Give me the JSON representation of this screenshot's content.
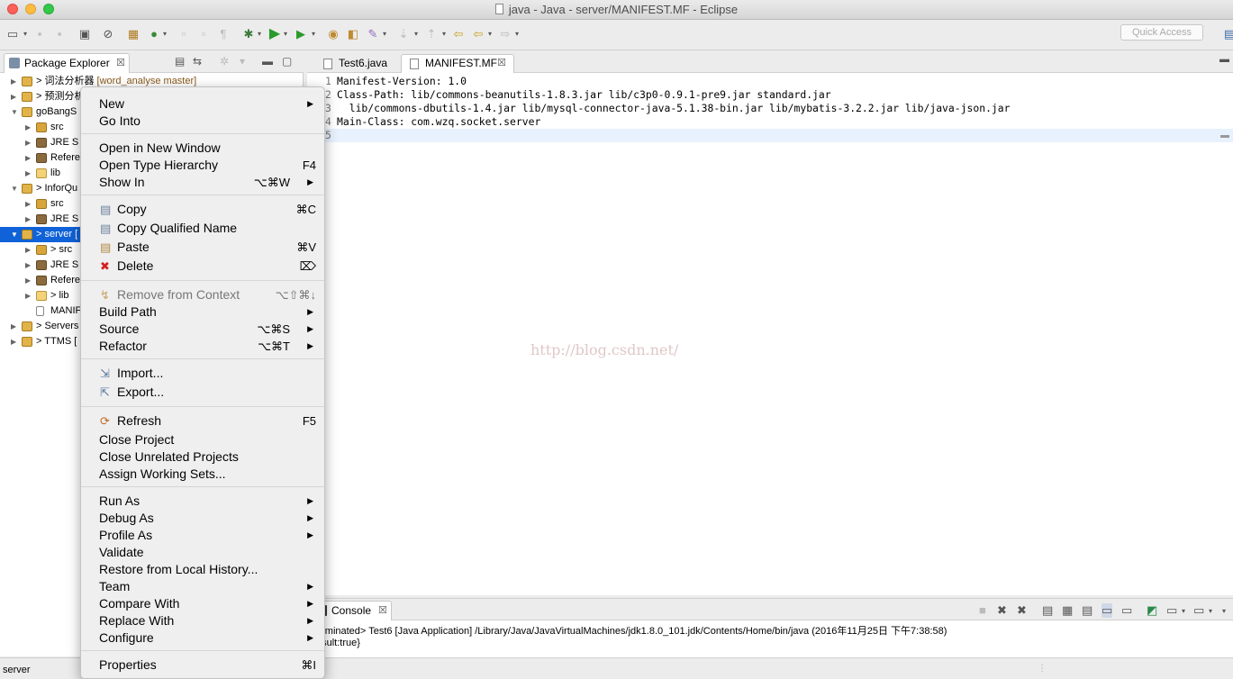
{
  "window": {
    "title": "java - Java - server/MANIFEST.MF - Eclipse"
  },
  "toolbar": {
    "quick_access": "Quick Access"
  },
  "package_explorer": {
    "tab_label": "Package Explorer",
    "rows": [
      {
        "label": "> 词法分析器",
        "decoration": " [word_analyse master]",
        "indent": 0,
        "expanded": false,
        "icon": "proj"
      },
      {
        "label": "> 预测分析",
        "decoration": "",
        "indent": 0,
        "expanded": false,
        "icon": "proj"
      },
      {
        "label": "goBangS",
        "decoration": "",
        "indent": 0,
        "expanded": true,
        "icon": "proj"
      },
      {
        "label": "src",
        "decoration": "",
        "indent": 1,
        "expanded": false,
        "icon": "src"
      },
      {
        "label": "JRE S",
        "decoration": "",
        "indent": 1,
        "expanded": false,
        "icon": "jre"
      },
      {
        "label": "Refere",
        "decoration": "",
        "indent": 1,
        "expanded": false,
        "icon": "ref"
      },
      {
        "label": "lib",
        "decoration": "",
        "indent": 1,
        "expanded": false,
        "icon": "folder"
      },
      {
        "label": "> InforQu",
        "decoration": "",
        "indent": 0,
        "expanded": true,
        "icon": "proj"
      },
      {
        "label": "src",
        "decoration": "",
        "indent": 1,
        "expanded": false,
        "icon": "src"
      },
      {
        "label": "JRE S",
        "decoration": "",
        "indent": 1,
        "expanded": false,
        "icon": "jre"
      },
      {
        "label": "> server [",
        "decoration": "",
        "indent": 0,
        "expanded": true,
        "icon": "proj",
        "selected": true
      },
      {
        "label": "> src",
        "decoration": "",
        "indent": 1,
        "expanded": false,
        "icon": "src"
      },
      {
        "label": "JRE S",
        "decoration": "",
        "indent": 1,
        "expanded": false,
        "icon": "jre"
      },
      {
        "label": "Refere",
        "decoration": "",
        "indent": 1,
        "expanded": false,
        "icon": "ref"
      },
      {
        "label": "> lib",
        "decoration": "",
        "indent": 1,
        "expanded": false,
        "icon": "folder"
      },
      {
        "label": "MANIF",
        "decoration": "",
        "indent": 1,
        "expanded": null,
        "icon": "file"
      },
      {
        "label": "> Servers",
        "decoration": "",
        "indent": 0,
        "expanded": false,
        "icon": "proj"
      },
      {
        "label": "> TTMS [",
        "decoration": "",
        "indent": 0,
        "expanded": false,
        "icon": "proj"
      }
    ]
  },
  "editor": {
    "tabs": [
      {
        "label": "Test6.java",
        "active": false
      },
      {
        "label": "MANIFEST.MF",
        "active": true
      }
    ],
    "lines": [
      {
        "num": "1",
        "text": "Manifest-Version: 1.0"
      },
      {
        "num": "2",
        "text": "Class-Path: lib/commons-beanutils-1.8.3.jar lib/c3p0-0.9.1-pre9.jar standard.jar"
      },
      {
        "num": "3",
        "text": "  lib/commons-dbutils-1.4.jar lib/mysql-connector-java-5.1.38-bin.jar lib/mybatis-3.2.2.jar lib/java-json.jar"
      },
      {
        "num": "4",
        "text": "Main-Class: com.wzq.socket.server"
      },
      {
        "num": "5",
        "text": ""
      }
    ],
    "watermark": "http://blog.csdn.net/"
  },
  "console": {
    "tab_label": "Console",
    "lines": [
      "erminated> Test6 [Java Application] /Library/Java/JavaVirtualMachines/jdk1.8.0_101.jdk/Contents/Home/bin/java (2016年11月25日 下午7:38:58)",
      "esult:true}"
    ]
  },
  "status": {
    "text": "server"
  },
  "context_menu": {
    "items": [
      {
        "id": "new",
        "label": "New",
        "submenu": true
      },
      {
        "id": "go-into",
        "label": "Go Into"
      },
      {
        "sep": true
      },
      {
        "id": "open-new-window",
        "label": "Open in New Window"
      },
      {
        "id": "open-type-hierarchy",
        "label": "Open Type Hierarchy",
        "shortcut": "F4"
      },
      {
        "id": "show-in",
        "label": "Show In",
        "shortcut": "⌥⌘W",
        "submenu": true
      },
      {
        "sep": true
      },
      {
        "id": "copy",
        "label": "Copy",
        "shortcut": "⌘C",
        "icon": "copy"
      },
      {
        "id": "copy-qualified-name",
        "label": "Copy Qualified Name",
        "icon": "copy"
      },
      {
        "id": "paste",
        "label": "Paste",
        "shortcut": "⌘V",
        "icon": "paste"
      },
      {
        "id": "delete",
        "label": "Delete",
        "shortcut": "⌦",
        "icon": "delete"
      },
      {
        "sep": true
      },
      {
        "id": "remove-from-context",
        "label": "Remove from Context",
        "shortcut": "⌥⇧⌘↓",
        "icon": "remove",
        "disabled": true
      },
      {
        "id": "build-path",
        "label": "Build Path",
        "submenu": true
      },
      {
        "id": "source",
        "label": "Source",
        "shortcut": "⌥⌘S",
        "submenu": true
      },
      {
        "id": "refactor",
        "label": "Refactor",
        "shortcut": "⌥⌘T",
        "submenu": true
      },
      {
        "sep": true
      },
      {
        "id": "import",
        "label": "Import...",
        "icon": "import"
      },
      {
        "id": "export",
        "label": "Export...",
        "icon": "export"
      },
      {
        "sep": true
      },
      {
        "id": "refresh",
        "label": "Refresh",
        "shortcut": "F5",
        "icon": "refresh"
      },
      {
        "id": "close-project",
        "label": "Close Project"
      },
      {
        "id": "close-unrelated-projects",
        "label": "Close Unrelated Projects"
      },
      {
        "id": "assign-working-sets",
        "label": "Assign Working Sets..."
      },
      {
        "sep": true
      },
      {
        "id": "run-as",
        "label": "Run As",
        "submenu": true
      },
      {
        "id": "debug-as",
        "label": "Debug As",
        "submenu": true
      },
      {
        "id": "profile-as",
        "label": "Profile As",
        "submenu": true
      },
      {
        "id": "validate",
        "label": "Validate"
      },
      {
        "id": "restore-local-history",
        "label": "Restore from Local History..."
      },
      {
        "id": "team",
        "label": "Team",
        "submenu": true
      },
      {
        "id": "compare-with",
        "label": "Compare With",
        "submenu": true
      },
      {
        "id": "replace-with",
        "label": "Replace With",
        "submenu": true
      },
      {
        "id": "configure",
        "label": "Configure",
        "submenu": true
      },
      {
        "sep": true
      },
      {
        "id": "properties",
        "label": "Properties",
        "shortcut": "⌘I"
      }
    ]
  }
}
